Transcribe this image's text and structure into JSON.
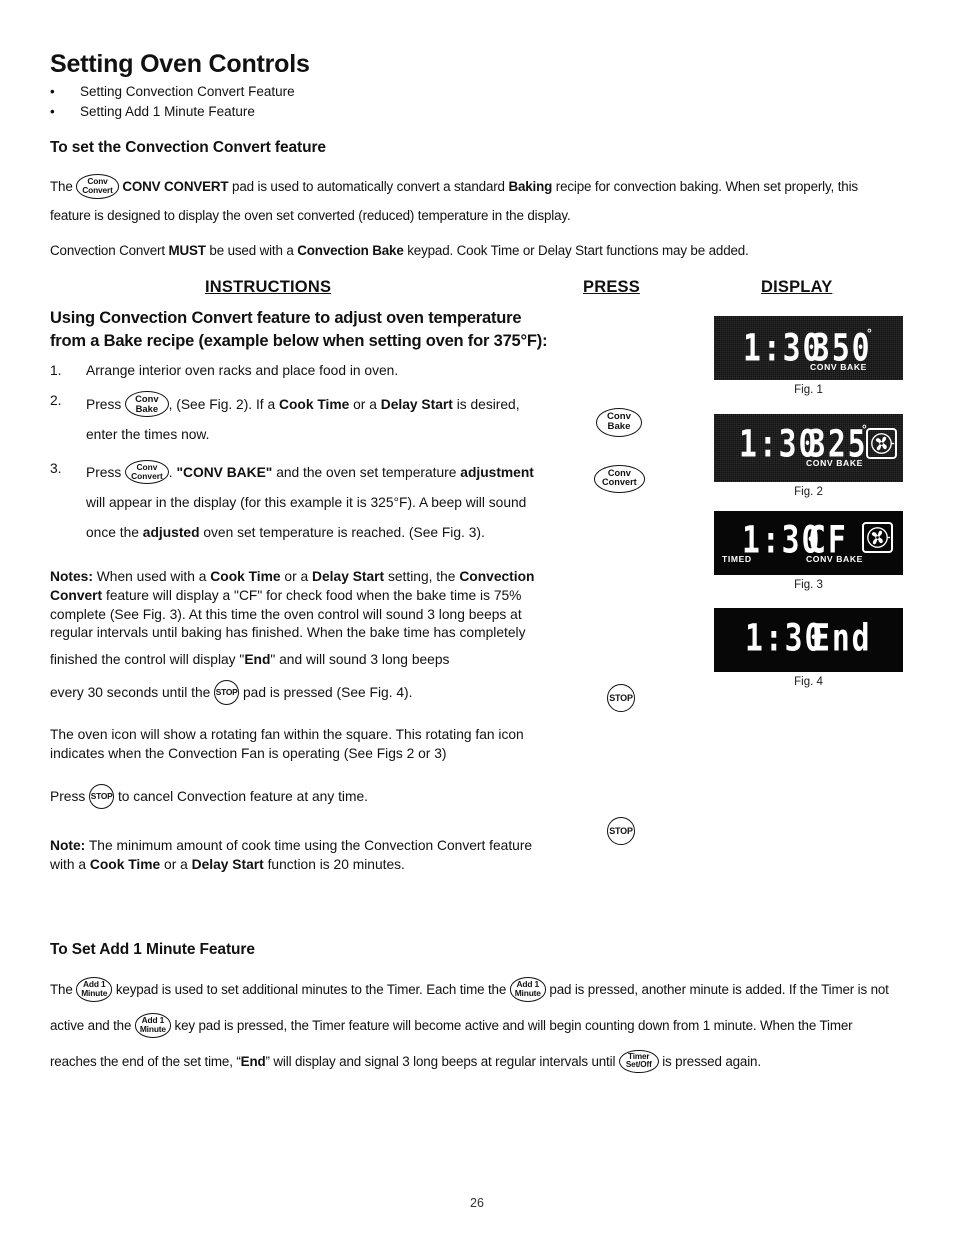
{
  "document": {
    "title": "Setting Oven Controls",
    "page_number": "26",
    "bullets": [
      "Setting Convection Convert Feature",
      "Setting Add 1 Minute Feature"
    ]
  },
  "section_convert": {
    "heading": "To set the Convection Convert feature",
    "intro_1": "The",
    "intro_2": "CONV CONVERT",
    "intro_3": "pad is used to automatically convert a standard",
    "intro_4": "Baking",
    "intro_5": "recipe for convection baking. When set properly, this feature is designed to display the oven set converted (reduced) temperature in the display.",
    "must_1": "Convection Convert",
    "must_2": "MUST",
    "must_3": "be used with a",
    "must_4": "Convection Bake",
    "must_5": "keypad. Cook Time or Delay Start functions may be added."
  },
  "columns": {
    "instructions": "INSTRUCTIONS",
    "press": "PRESS",
    "display": "DISPLAY"
  },
  "instructions": {
    "lead_in": "Using Convection Convert feature to adjust oven temperature from a Bake recipe (example below when setting oven for 375°F):",
    "step1": {
      "num": "1.",
      "text": "Arrange interior oven racks and place food in oven."
    },
    "step2": {
      "num": "2.",
      "press_word": "Press",
      "after_pad": ",  (See Fig. 2). If a",
      "bold_a": "Cook Time",
      "mid": "or a",
      "bold_b": "Delay Start",
      "tail": "is desired, enter the times now."
    },
    "step3": {
      "num": "3.",
      "press_word": "Press",
      "after_pad": ".",
      "bold_a": "\"CONV BAKE\"",
      "t1": "and the oven set temperature",
      "bold_b": "adjustment",
      "t2": "will appear in the display (for this example it is 325°F). A beep will sound once the",
      "bold_c": "adjusted",
      "t3": "oven set temperature is reached. (See Fig. 3)."
    },
    "notes": {
      "label": "Notes:",
      "n1": "When used with a",
      "bold_a": "Cook Time",
      "n2": "or a",
      "bold_b": "Delay Start",
      "n3": "setting, the",
      "bold_c": "Convection Convert",
      "n4": "feature will display a \"CF\" for check food when the bake time is 75% complete (See Fig. 3). At this time the oven control will sound 3 long beeps at regular intervals until baking has finished. When the bake time has completely finished the control will display \"",
      "bold_d": "End",
      "n5": "\" and will sound 3 long beeps",
      "last_a": "every 30 seconds until the",
      "last_b": "pad is pressed (See Fig. 4)."
    },
    "fan_para": "The oven icon will show a rotating fan within the square. This rotating fan icon indicates when the Convection Fan is operating (See Figs 2 or 3)",
    "cancel_para": {
      "a": "Press",
      "b": "to cancel Convection feature at any time."
    },
    "note_min": {
      "label": "Note:",
      "n1": "The minimum amount of cook time using the Convection Convert feature with a",
      "bold_a": "Cook Time",
      "n2": "or a",
      "bold_b": "Delay Start",
      "n3": "function is 20 minutes."
    }
  },
  "press_column": [
    {
      "name": "conv-bake",
      "line1": "Conv",
      "line2": "Bake"
    },
    {
      "name": "conv-convert",
      "line1": "Conv",
      "line2": "Convert"
    },
    {
      "name": "stop-1",
      "label": "STOP"
    },
    {
      "name": "stop-2",
      "label": "STOP"
    }
  ],
  "pads": {
    "conv_convert": {
      "line1": "Conv",
      "line2": "Convert"
    },
    "conv_bake": {
      "line1": "Conv",
      "line2": "Bake"
    },
    "stop": "STOP",
    "add1": {
      "line1": "Add 1",
      "line2": "Minute"
    },
    "timer": {
      "line1": "Timer",
      "line2": "Set/Off"
    }
  },
  "figures": [
    {
      "id": "fig1",
      "caption": "Fig. 1",
      "time": "1:30",
      "value": "350",
      "degree": "°",
      "indicator_right": "CONV  BAKE",
      "indicator_left": "",
      "fan": false,
      "noisy": true
    },
    {
      "id": "fig2",
      "caption": "Fig. 2",
      "time": "1:30",
      "value": "325",
      "degree": "°",
      "indicator_right": "CONV  BAKE",
      "indicator_left": "",
      "fan": true,
      "noisy": true
    },
    {
      "id": "fig3",
      "caption": "Fig. 3",
      "time": "1:30",
      "value": "CF",
      "degree": "",
      "indicator_right": "CONV  BAKE",
      "indicator_left": "TIMED",
      "fan": true,
      "noisy": false
    },
    {
      "id": "fig4",
      "caption": "Fig. 4",
      "time": "1:30",
      "value": "End",
      "degree": "",
      "indicator_right": "",
      "indicator_left": "",
      "fan": false,
      "noisy": false
    }
  ],
  "section_add1": {
    "heading": "To Set  Add 1 Minute Feature",
    "t1": "The",
    "t2": "keypad is used to set additional minutes to the Timer. Each time the",
    "t3": "pad is pressed, another minute is added. If the Timer is not active and the",
    "t4": "key pad is pressed, the Timer feature will become active and will begin counting down from 1 minute. When the Timer reaches the end of the set time, “",
    "bold_end": "End",
    "t5": "” will display and signal 3 long beeps at regular intervals until",
    "t6": "is pressed again."
  },
  "colors": {
    "display_bg": "#070707",
    "display_fg": "#ffffff",
    "text": "#111111"
  }
}
